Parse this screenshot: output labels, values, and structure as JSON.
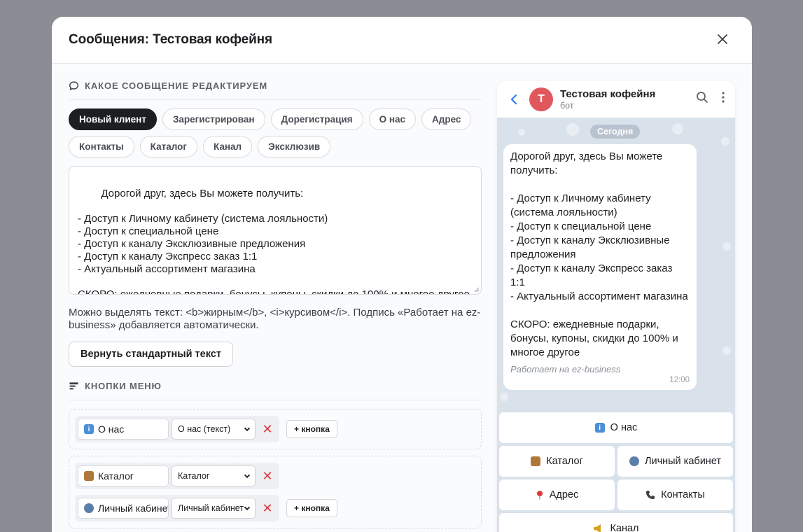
{
  "modal": {
    "title": "Сообщения: Тестовая кофейня"
  },
  "section_message": {
    "title": "Какое сообщение редактируем",
    "chips": [
      {
        "label": "Новый клиент",
        "active": true
      },
      {
        "label": "Зарегистрирован"
      },
      {
        "label": "Дорегистрация"
      },
      {
        "label": "О нас"
      },
      {
        "label": "Адрес"
      },
      {
        "label": "Контакты"
      },
      {
        "label": "Каталог"
      },
      {
        "label": "Канал"
      },
      {
        "label": "Эксклюзив"
      }
    ],
    "editor_text": "Дорогой друг, здесь Вы можете получить:\n\n- Доступ к Личному кабинету (система лояльности)\n- Доступ к специальной цене\n- Доступ к каналу Эксклюзивные предложения\n- Доступ к каналу Экспресс заказ 1:1\n- Актуальный ассортимент магазина\n\nСКОРО: ежедневные подарки, бонусы, купоны, скидки до 100% и многое другое",
    "hint": "Можно выделять текст: <b>жирным</b>, <i>курсивом</i>. Подпись «Работает на ez-business» добавляется автоматически.",
    "reset_label": "Вернуть стандартный текст"
  },
  "section_buttons": {
    "title": "Кнопки меню",
    "row1": {
      "label": "О нас",
      "select": "О нас (текст)",
      "add": "+ кнопка"
    },
    "row2a": {
      "label": "Каталог",
      "select": "Каталог"
    },
    "row2b": {
      "label": "Личный кабинет",
      "select": "Личный кабинет",
      "add": "+ кнопка"
    }
  },
  "preview": {
    "chat_name": "Тестовая кофейня",
    "chat_status": "бот",
    "avatar_letter": "Т",
    "date": "Сегодня",
    "message": "Дорогой друг, здесь Вы можете получить:\n\n- Доступ к Личному кабинету (система лояльности)\n- Доступ к специальной цене\n- Доступ к каналу Эксклюзивные предложения\n- Доступ к каналу Экспресс заказ 1:1\n- Актуальный ассортимент магазина\n\nСКОРО: ежедневные подарки, бонусы, купоны, скидки до 100% и многое другое",
    "signature": "Работает на ez-business",
    "time": "12:00",
    "keyboard": {
      "about": "О нас",
      "catalog": "Каталог",
      "cabinet": "Личный кабинет",
      "address": "Адрес",
      "contacts": "Контакты",
      "channel": "Канал"
    }
  },
  "colors": {
    "accent": "#1c1e21",
    "avatar": "#e0585c",
    "danger": "#e0383e",
    "link": "#2f80ed"
  }
}
